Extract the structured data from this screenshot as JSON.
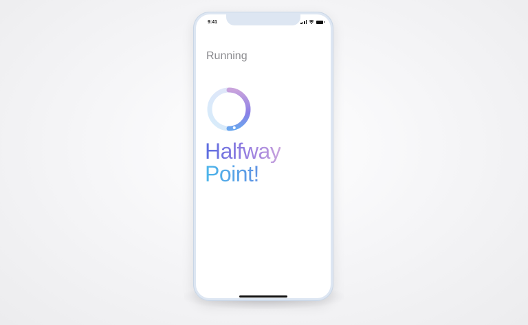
{
  "status_bar": {
    "time": "9:41",
    "icons": [
      "signal-icon",
      "wifi-icon",
      "battery-icon"
    ]
  },
  "screen": {
    "title": "Running",
    "progress": 0.5,
    "headline_line1": "Halfway",
    "headline_line2": "Point!"
  },
  "colors": {
    "ring_track": "#dbe9fb",
    "ring_start": "#6aa6ee",
    "ring_mid": "#8b7fe6",
    "ring_end": "#c9a3dc",
    "title": "#8a8a8e",
    "frame": "#dde6f2"
  }
}
